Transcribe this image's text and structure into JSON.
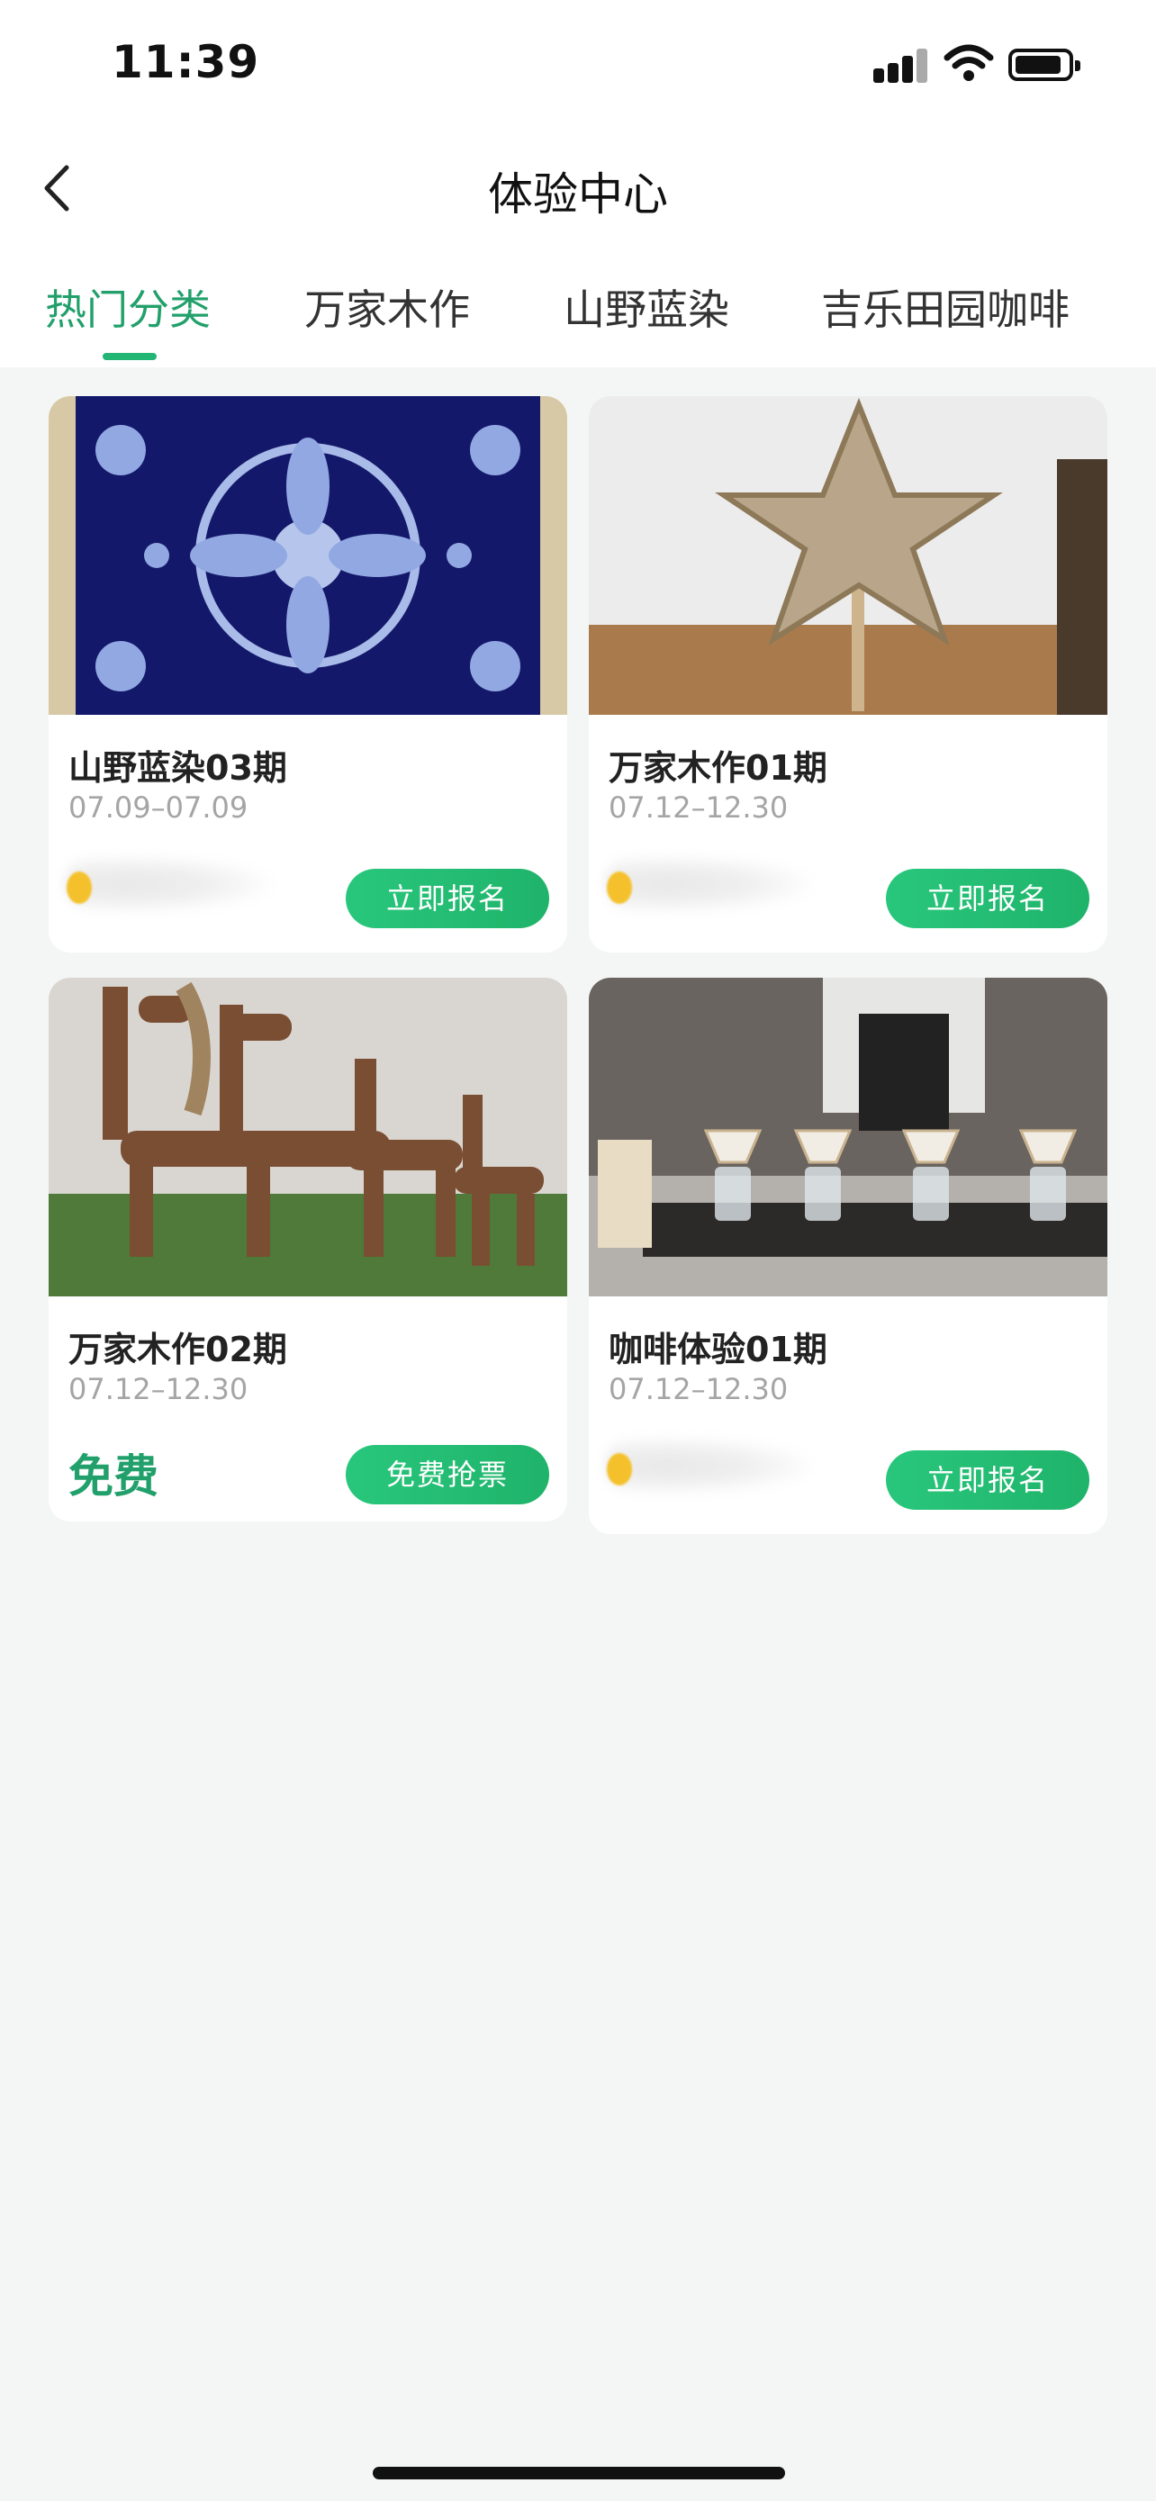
{
  "status_bar": {
    "time": "11:39"
  },
  "nav": {
    "title": "体验中心"
  },
  "tabs": [
    {
      "label": "热门分类",
      "active": true
    },
    {
      "label": "万家木作",
      "active": false
    },
    {
      "label": "山野蓝染",
      "active": false
    },
    {
      "label": "吉乐田园咖啡",
      "active": false
    }
  ],
  "cards": [
    {
      "title": "山野蓝染03期",
      "date": "07.09–07.09",
      "price": "",
      "button": "立即报名"
    },
    {
      "title": "万家木作01期",
      "date": "07.12–12.30",
      "price": "",
      "button": "立即报名"
    },
    {
      "title": "万家木作02期",
      "date": "07.12–12.30",
      "price": "免费",
      "button": "免费抢票"
    },
    {
      "title": "咖啡体验01期",
      "date": "07.12–12.30",
      "price": "",
      "button": "立即报名"
    }
  ],
  "colors": {
    "accent": "#22a06b",
    "button": "#1fb36a",
    "background": "#f4f6f6"
  }
}
